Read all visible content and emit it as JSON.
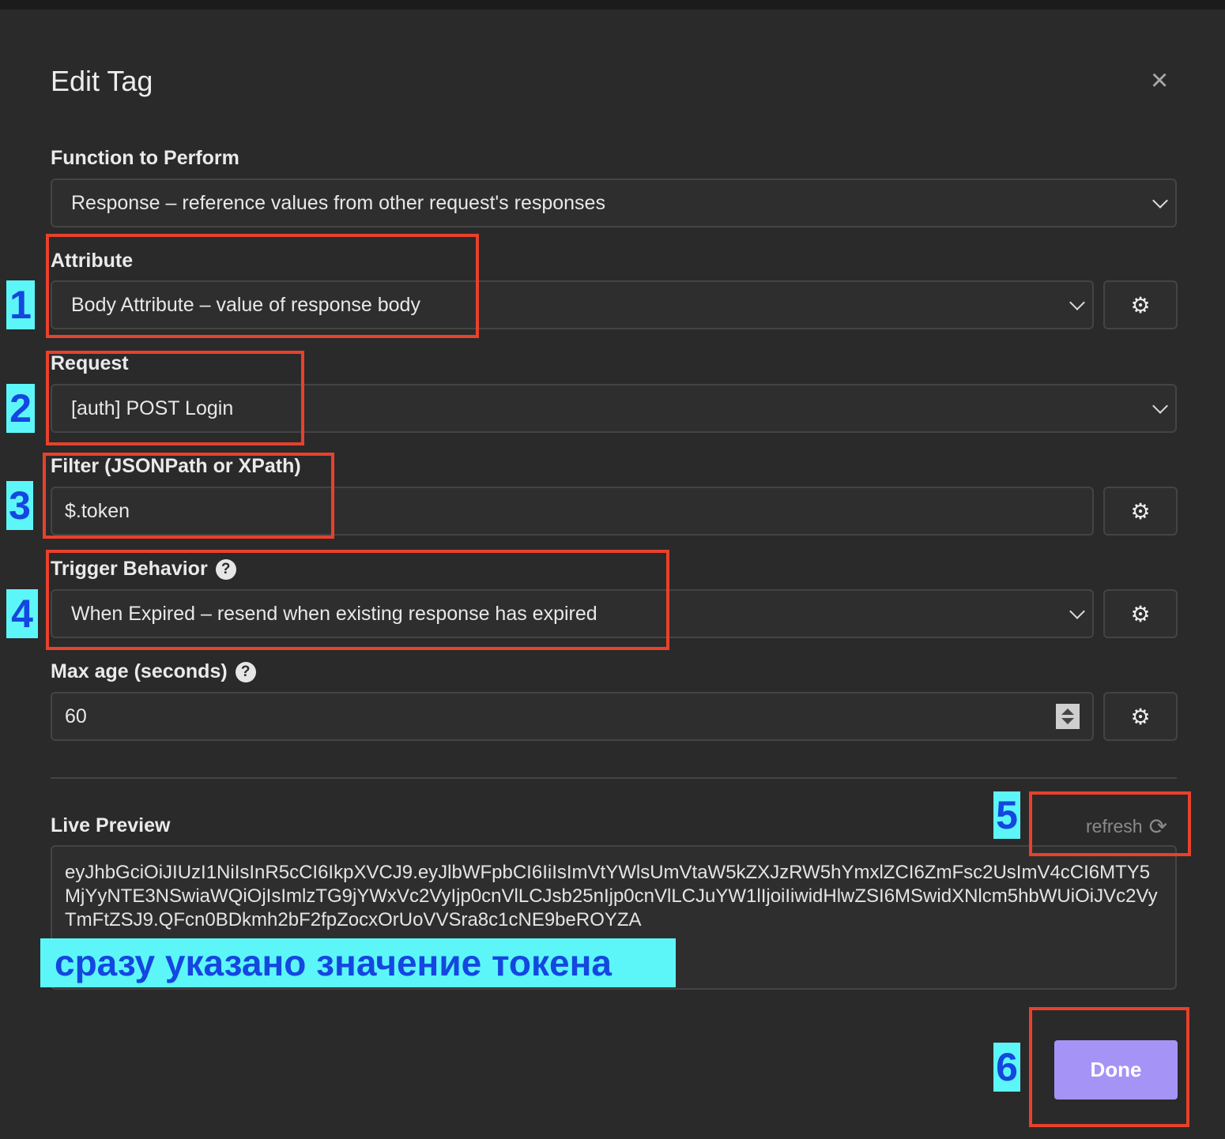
{
  "dialog": {
    "title": "Edit Tag",
    "close_icon": "×"
  },
  "fields": {
    "function": {
      "label": "Function to Perform",
      "value": "Response – reference values from other request's responses"
    },
    "attribute": {
      "label": "Attribute",
      "value": "Body Attribute – value of response body"
    },
    "request": {
      "label": "Request",
      "value": "[auth] POST Login"
    },
    "filter": {
      "label": "Filter (JSONPath or XPath)",
      "value": "$.token"
    },
    "trigger": {
      "label": "Trigger Behavior",
      "value": "When Expired – resend when existing response has expired"
    },
    "max_age": {
      "label": "Max age (seconds)",
      "value": "60"
    }
  },
  "help_icon": "?",
  "gear_icon": "⚙",
  "preview": {
    "label": "Live Preview",
    "refresh_label": "refresh",
    "refresh_icon": "⟳",
    "value": "eyJhbGciOiJIUzI1NiIsInR5cCI6IkpXVCJ9.eyJlbWFpbCI6IiIsImVtYWlsUmVtaW5kZXJzRW5hYmxlZCI6ZmFsc2UsImV4cCI6MTY5MjYyNTE3NSwiaWQiOjIsImlzTG9jYWxVc2VyIjp0cnVlLCJsb25nIjp0cnVlLCJuYW1lIjoiIiwidHlwZSI6MSwidXNlcm5hbWUiOiJVc2VyTmFtZSJ9.QFcn0BDkmh2bF2fpZocxOrUoVVSra8c1cNE9beROYZA"
  },
  "done_label": "Done",
  "annotations": {
    "numbers": [
      "1",
      "2",
      "3",
      "4",
      "5",
      "6"
    ],
    "banner": "сразу указано значение токена"
  },
  "colors": {
    "accent": "#a594f6",
    "annotation_box": "#e8412c",
    "annotation_label_bg": "#5cf6f8"
  }
}
